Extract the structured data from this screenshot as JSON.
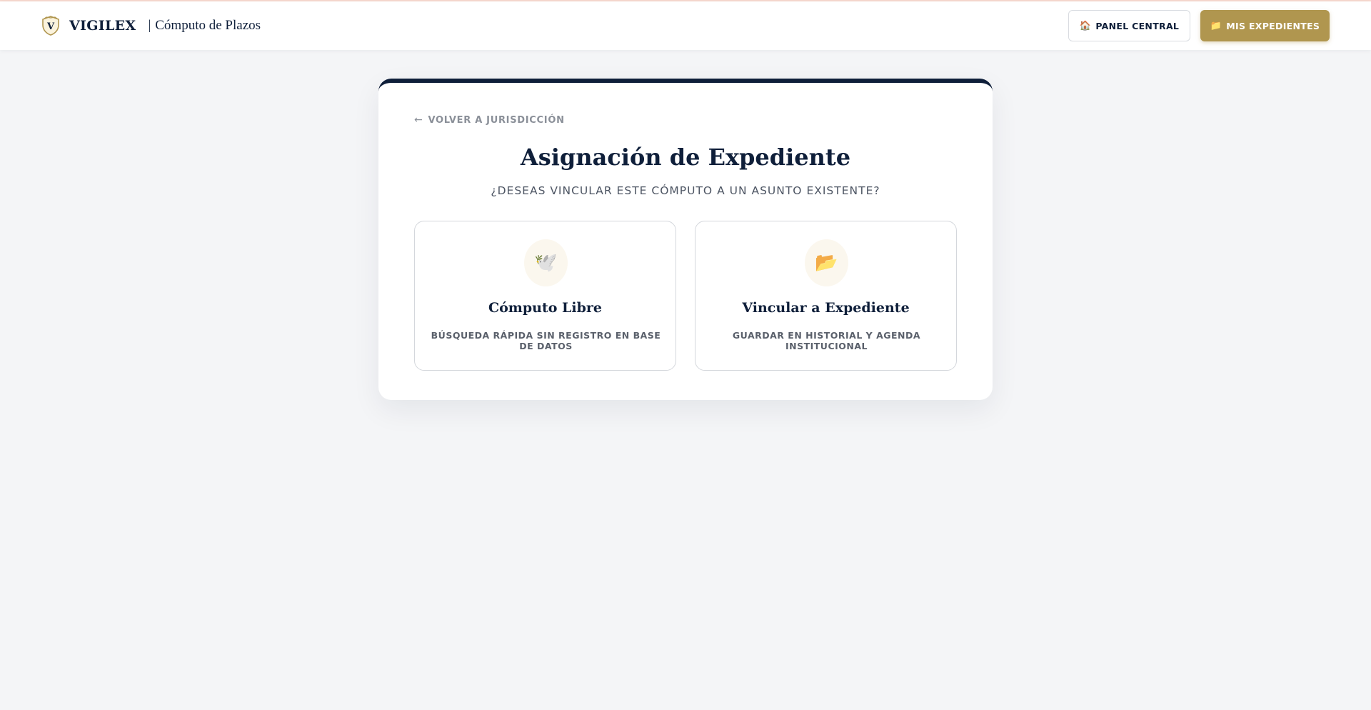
{
  "header": {
    "brand_name": "VIGILEX",
    "separator": "|",
    "module_name": "Cómputo de Plazos",
    "logo_letter": "V",
    "logo_icon": "shield-v-logo-icon",
    "nav": {
      "panel_icon": "🏠",
      "panel_label": "PANEL CENTRAL",
      "expedientes_icon": "📁",
      "expedientes_label": "MIS EXPEDIENTES"
    }
  },
  "card": {
    "back_icon": "←",
    "back_label": "VOLVER A JURISDICCIÓN",
    "title": "Asignación de Expediente",
    "subtitle": "¿DESEAS VINCULAR ESTE CÓMPUTO A UN ASUNTO EXISTENTE?",
    "options": [
      {
        "icon": "🕊️",
        "icon_name": "dove-icon",
        "title": "Cómputo Libre",
        "description": "BÚSQUEDA RÁPIDA SIN REGISTRO EN BASE DE DATOS"
      },
      {
        "icon": "📂",
        "icon_name": "open-folder-icon",
        "title": "Vincular a Expediente",
        "description": "GUARDAR EN HISTORIAL Y AGENDA INSTITUCIONAL"
      }
    ]
  },
  "colors": {
    "navy": "#0f1f3a",
    "gold": "#b0964f",
    "background": "#f4f5f7"
  }
}
